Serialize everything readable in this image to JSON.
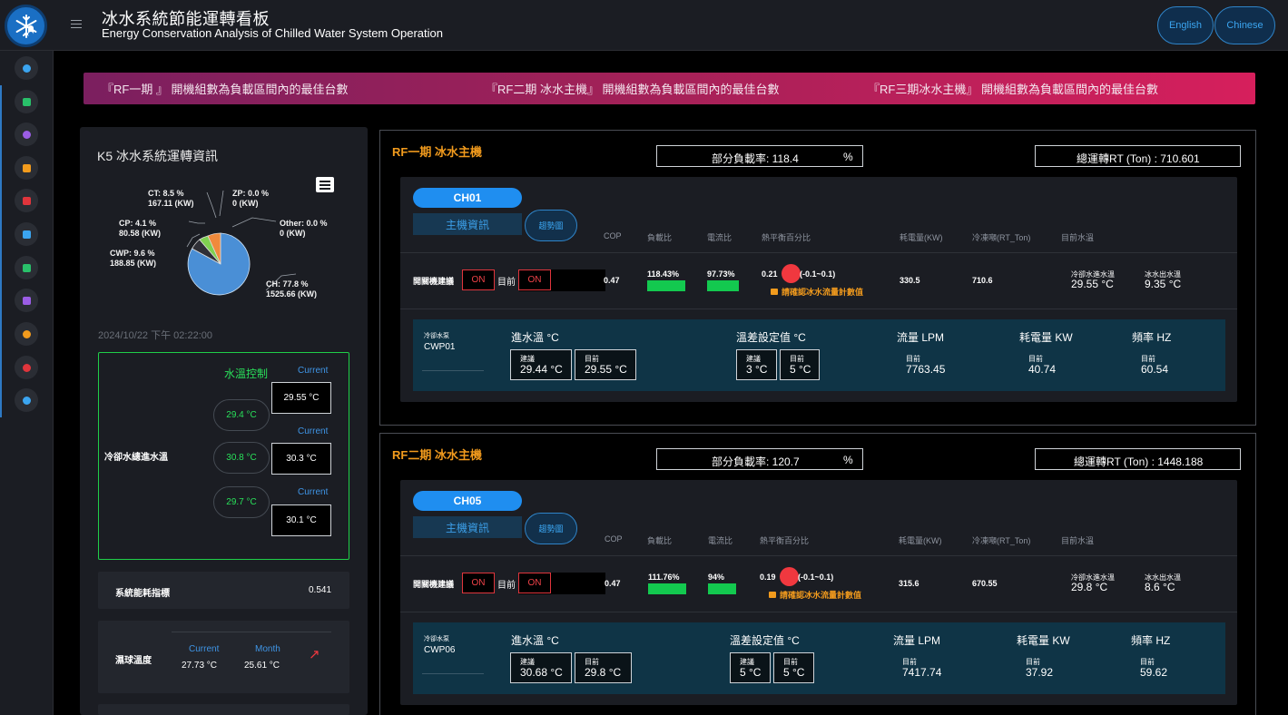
{
  "header": {
    "title_zh": "冰水系統節能運轉看板",
    "title_en": "Energy Conservation Analysis of Chilled Water System Operation",
    "lang_english": "English",
    "lang_chinese": "Chinese"
  },
  "colors": {
    "accent": "#1f8ef0",
    "warning": "#f29b1d",
    "good": "#13c94f",
    "alert": "#f0383f"
  },
  "sidebar": {
    "items": [
      {
        "icon": "home-icon",
        "color": "#3ba5f0"
      },
      {
        "icon": "grid-icon",
        "color": "#29c06a"
      },
      {
        "icon": "gauge-icon",
        "color": "#9b5de5"
      },
      {
        "icon": "list-icon",
        "color": "#f29b1d"
      },
      {
        "icon": "bar-chart-icon",
        "color": "#e0353c"
      },
      {
        "icon": "bar-chart-icon",
        "color": "#3ba5f0"
      },
      {
        "icon": "bar-chart-icon",
        "color": "#29c06a"
      },
      {
        "icon": "table-icon",
        "color": "#9b5de5"
      },
      {
        "icon": "gauge-icon",
        "color": "#f29b1d"
      },
      {
        "icon": "gauge-icon",
        "color": "#e0353c"
      },
      {
        "icon": "gauge-icon",
        "color": "#3ba5f0"
      }
    ]
  },
  "banner": {
    "rf1": "『RF一期 』 開機組數為負載區間內的最佳台數",
    "rf2": "『RF二期 冰水主機』 開機組數為負載區間內的最佳台數",
    "rf3": "『RF三期冰水主機』 開機組數為負載區間內的最佳台數"
  },
  "left": {
    "title": "K5 冰水系統運轉資訊",
    "pie": {
      "ct_name": "CT: 8.5 %",
      "ct_kw": "167.11 (KW)",
      "zp_name": "ZP: 0.0 %",
      "zp_kw": "0 (KW)",
      "cp_name": "CP: 4.1 %",
      "cp_kw": "80.58 (KW)",
      "other_name": "Other: 0.0 %",
      "other_kw": "0 (KW)",
      "cwp_name": "CWP: 9.6 %",
      "cwp_kw": "188.85 (KW)",
      "ch_name": "CH: 77.8 %",
      "ch_kw": "1525.66 (KW)"
    },
    "datetime": "2024/10/22 下午 02:22:00",
    "control": {
      "title": "水溫控制",
      "side_label": "冷卻水總進水溫",
      "rows": [
        {
          "current_label": "Current",
          "set": "29.4 °C",
          "current": "29.55 °C"
        },
        {
          "current_label": "Current",
          "set": "30.8 °C",
          "current": "30.3 °C"
        },
        {
          "current_label": "Current",
          "set": "29.7 °C",
          "current": "30.1 °C"
        }
      ]
    },
    "efficiency": {
      "label": "系統能耗指標",
      "value": "0.541"
    },
    "wetbulb": {
      "label": "濕球溫度",
      "current_label": "Current",
      "month_label": "Month",
      "current": "27.73 °C",
      "month": "25.61 °C",
      "trend": "↗"
    }
  },
  "rf1": {
    "title": "RF一期 冰水主機",
    "load": "部分負載率: 118.4",
    "load_unit": "%",
    "rt": "總運轉RT (Ton) : 710.601",
    "chiller": {
      "tab": "CH01",
      "info": "主機資訊",
      "trend": "趨勢圖",
      "headers": [
        "COP",
        "負載比",
        "電流比",
        "熱平衡百分比",
        "耗電量(KW)",
        "冷凍噸(RT_Ton)",
        "目前水溫"
      ],
      "suggest_label": "開關機建議",
      "suggest": "ON",
      "now_label": "目前",
      "now": "ON",
      "cop": "0.47",
      "load_ratio": "118.43%",
      "current_ratio": "97.73%",
      "heat_balance": "0.21",
      "heat_range": "(-0.1~0.1)",
      "warn": "請確認冰水流量計數值",
      "kw": "330.5",
      "rt": "710.6",
      "cw_in_label": "冷卻水進水溫",
      "cw_in": "29.55 °C",
      "chw_out_label": "冰水出水溫",
      "chw_out": "9.35 °C",
      "pump": {
        "type": "冷卻水泵",
        "name": "CWP01",
        "inlet_label": "進水溫 °C",
        "sugg_label": "建議",
        "inlet_sugg": "29.44 °C",
        "now_label": "目前",
        "inlet_now": "29.55 °C",
        "diff_label": "溫差設定值 °C",
        "diff_sugg": "3 °C",
        "diff_now": "5 °C",
        "flow_label": "流量 LPM",
        "flow": "7763.45",
        "kw_label": "耗電量 KW",
        "kw": "40.74",
        "hz_label": "頻率 HZ",
        "hz": "60.54"
      }
    }
  },
  "rf2": {
    "title": "RF二期 冰水主機",
    "load": "部分負載率: 120.7",
    "load_unit": "%",
    "rt": "總運轉RT (Ton) : 1448.188",
    "chiller": {
      "tab": "CH05",
      "info": "主機資訊",
      "trend": "趨勢圖",
      "headers": [
        "COP",
        "負載比",
        "電流比",
        "熱平衡百分比",
        "耗電量(KW)",
        "冷凍噸(RT_Ton)",
        "目前水溫"
      ],
      "suggest_label": "開關機建議",
      "suggest": "ON",
      "now_label": "目前",
      "now": "ON",
      "cop": "0.47",
      "load_ratio": "111.76%",
      "current_ratio": "94%",
      "heat_balance": "0.19",
      "heat_range": "(-0.1~0.1)",
      "warn": "請確認冰水流量計數值",
      "kw": "315.6",
      "rt": "670.55",
      "cw_in_label": "冷卻水進水溫",
      "cw_in": "29.8 °C",
      "chw_out_label": "冰水出水溫",
      "chw_out": "8.6 °C",
      "pump": {
        "type": "冷卻水泵",
        "name": "CWP06",
        "inlet_label": "進水溫 °C",
        "sugg_label": "建議",
        "inlet_sugg": "30.68 °C",
        "now_label": "目前",
        "inlet_now": "29.8 °C",
        "diff_label": "溫差設定值 °C",
        "diff_sugg": "5 °C",
        "diff_now": "5 °C",
        "flow_label": "流量 LPM",
        "flow": "7417.74",
        "kw_label": "耗電量 KW",
        "kw": "37.92",
        "hz_label": "頻率 HZ",
        "hz": "59.62"
      }
    }
  }
}
